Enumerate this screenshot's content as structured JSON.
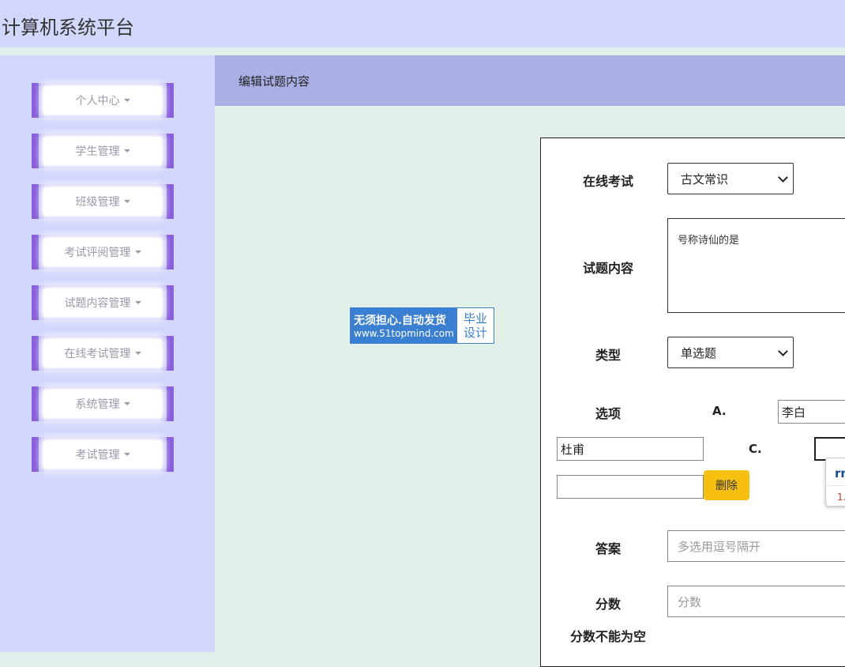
{
  "app": {
    "title": "计算机系统平台"
  },
  "sidebar": {
    "items": [
      {
        "label": "个人中心"
      },
      {
        "label": "学生管理"
      },
      {
        "label": "班级管理"
      },
      {
        "label": "考试评阅管理"
      },
      {
        "label": "试题内容管理"
      },
      {
        "label": "在线考试管理"
      },
      {
        "label": "系统管理"
      },
      {
        "label": "考试管理"
      }
    ]
  },
  "breadcrumb": {
    "title": "编辑试题内容"
  },
  "watermark": {
    "line1": "无须担心.自动发货",
    "line2": "www.51topmind.com",
    "tag1": "毕业",
    "tag2": "设计"
  },
  "form": {
    "exam": {
      "label": "在线考试",
      "value": "古文常识"
    },
    "content": {
      "label": "试题内容",
      "value": "号称诗仙的是"
    },
    "type": {
      "label": "类型",
      "value": "单选题"
    },
    "options": {
      "label": "选项",
      "a_letter": "A.",
      "a_value": "李白",
      "b_value": "杜甫",
      "c_letter": "C.",
      "c_value": "",
      "extra_value": "",
      "delete_label": "删除"
    },
    "popup": {
      "text1": "rn",
      "text2": "1."
    },
    "answer": {
      "label": "答案",
      "placeholder": "多选用逗号隔开"
    },
    "score": {
      "label": "分数",
      "placeholder": "分数",
      "error": "分数不能为空"
    }
  },
  "colors": {
    "header_bg": "#d2d8fc",
    "sidebar_accent": "#8a60dc",
    "breadcrumb_bg": "#a9b0e6",
    "content_bg": "#e2f0ea",
    "delete_button": "#f7bf10"
  }
}
